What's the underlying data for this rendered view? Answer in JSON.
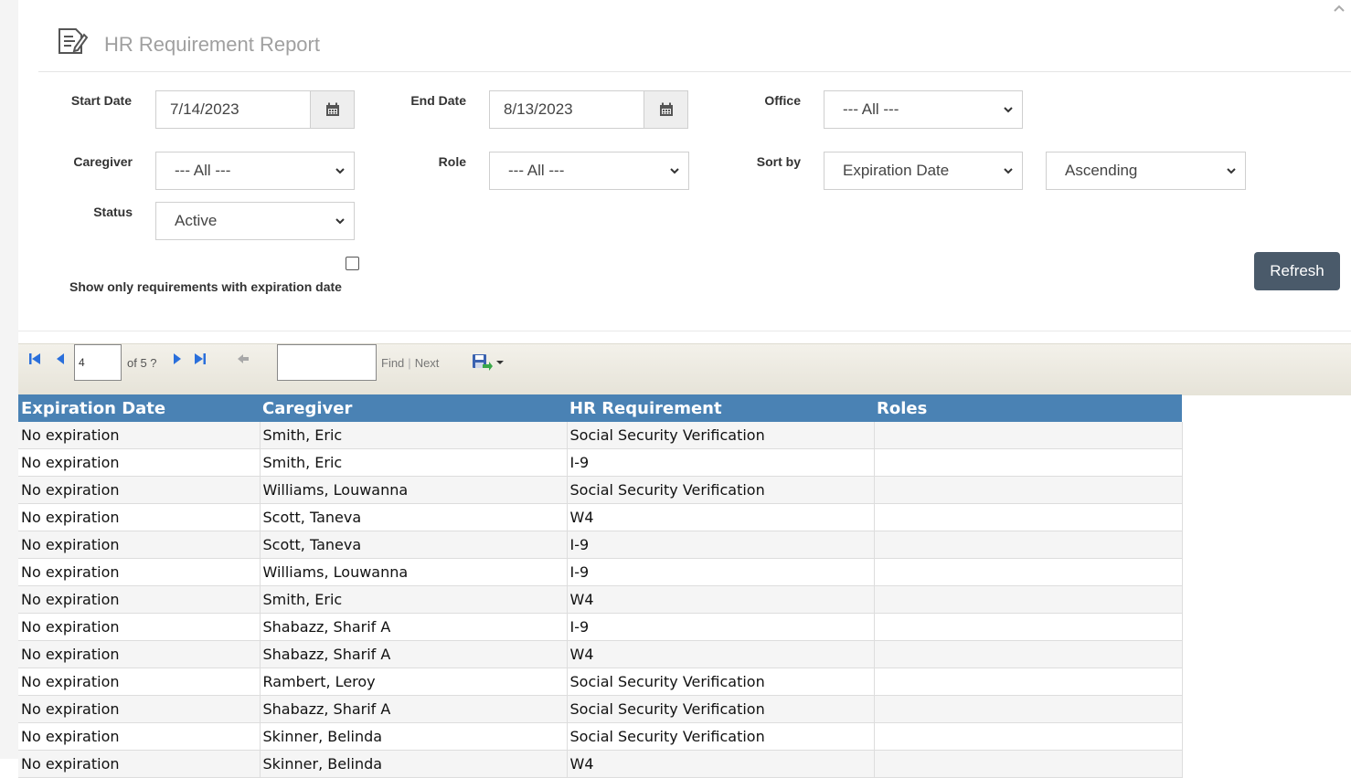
{
  "header": {
    "title": "HR Requirement Report"
  },
  "filters": {
    "start_date_label": "Start Date",
    "start_date_value": "7/14/2023",
    "end_date_label": "End Date",
    "end_date_value": "8/13/2023",
    "office_label": "Office",
    "office_value": "--- All ---",
    "caregiver_label": "Caregiver",
    "caregiver_value": "--- All ---",
    "role_label": "Role",
    "role_value": "--- All ---",
    "sort_label": "Sort by",
    "sort_value": "Expiration Date",
    "sort_order_value": "Ascending",
    "status_label": "Status",
    "status_value": "Active",
    "expiration_checkbox_label": "Show only requirements with expiration date",
    "refresh_label": "Refresh"
  },
  "toolbar": {
    "page_number": "4",
    "page_of": "of 5 ?",
    "find_label": "Find",
    "next_label": "Next"
  },
  "table": {
    "columns": [
      "Expiration Date",
      "Caregiver",
      "HR Requirement",
      "Roles"
    ],
    "rows": [
      [
        "No expiration",
        "Smith, Eric",
        "Social Security Verification",
        ""
      ],
      [
        "No expiration",
        "Smith, Eric",
        "I-9",
        ""
      ],
      [
        "No expiration",
        "Williams, Louwanna",
        "Social Security Verification",
        ""
      ],
      [
        "No expiration",
        "Scott, Taneva",
        "W4",
        ""
      ],
      [
        "No expiration",
        "Scott, Taneva",
        "I-9",
        ""
      ],
      [
        "No expiration",
        "Williams, Louwanna",
        "I-9",
        ""
      ],
      [
        "No expiration",
        "Smith, Eric",
        "W4",
        ""
      ],
      [
        "No expiration",
        "Shabazz, Sharif A",
        "I-9",
        ""
      ],
      [
        "No expiration",
        "Shabazz, Sharif A",
        "W4",
        ""
      ],
      [
        "No expiration",
        "Rambert, Leroy",
        "Social Security Verification",
        ""
      ],
      [
        "No expiration",
        "Shabazz, Sharif A",
        "Social Security Verification",
        ""
      ],
      [
        "No expiration",
        "Skinner, Belinda",
        "Social Security Verification",
        ""
      ],
      [
        "No expiration",
        "Skinner, Belinda",
        "W4",
        ""
      ]
    ]
  },
  "colors": {
    "header_blue": "#4a82b4",
    "refresh_bg": "#4a5a6a",
    "nav_blue": "#2a6fdb"
  }
}
